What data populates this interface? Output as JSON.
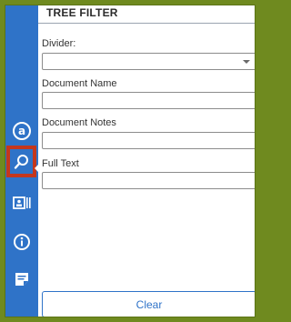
{
  "panel": {
    "title": "TREE FILTER"
  },
  "fields": {
    "divider": {
      "label": "Divider:",
      "value": ""
    },
    "document_name": {
      "label": "Document Name",
      "value": ""
    },
    "document_notes": {
      "label": "Document Notes",
      "value": ""
    },
    "full_text": {
      "label": "Full Text",
      "value": ""
    }
  },
  "actions": {
    "clear_label": "Clear"
  },
  "rail": {
    "icons": [
      "at-sign-icon",
      "search-filter-icon",
      "id-card-icon",
      "info-icon",
      "notes-icon"
    ]
  },
  "colors": {
    "rail_blue": "#2f73c8",
    "active_highlight": "#c4371d",
    "outer_border": "#6f8a1f"
  }
}
